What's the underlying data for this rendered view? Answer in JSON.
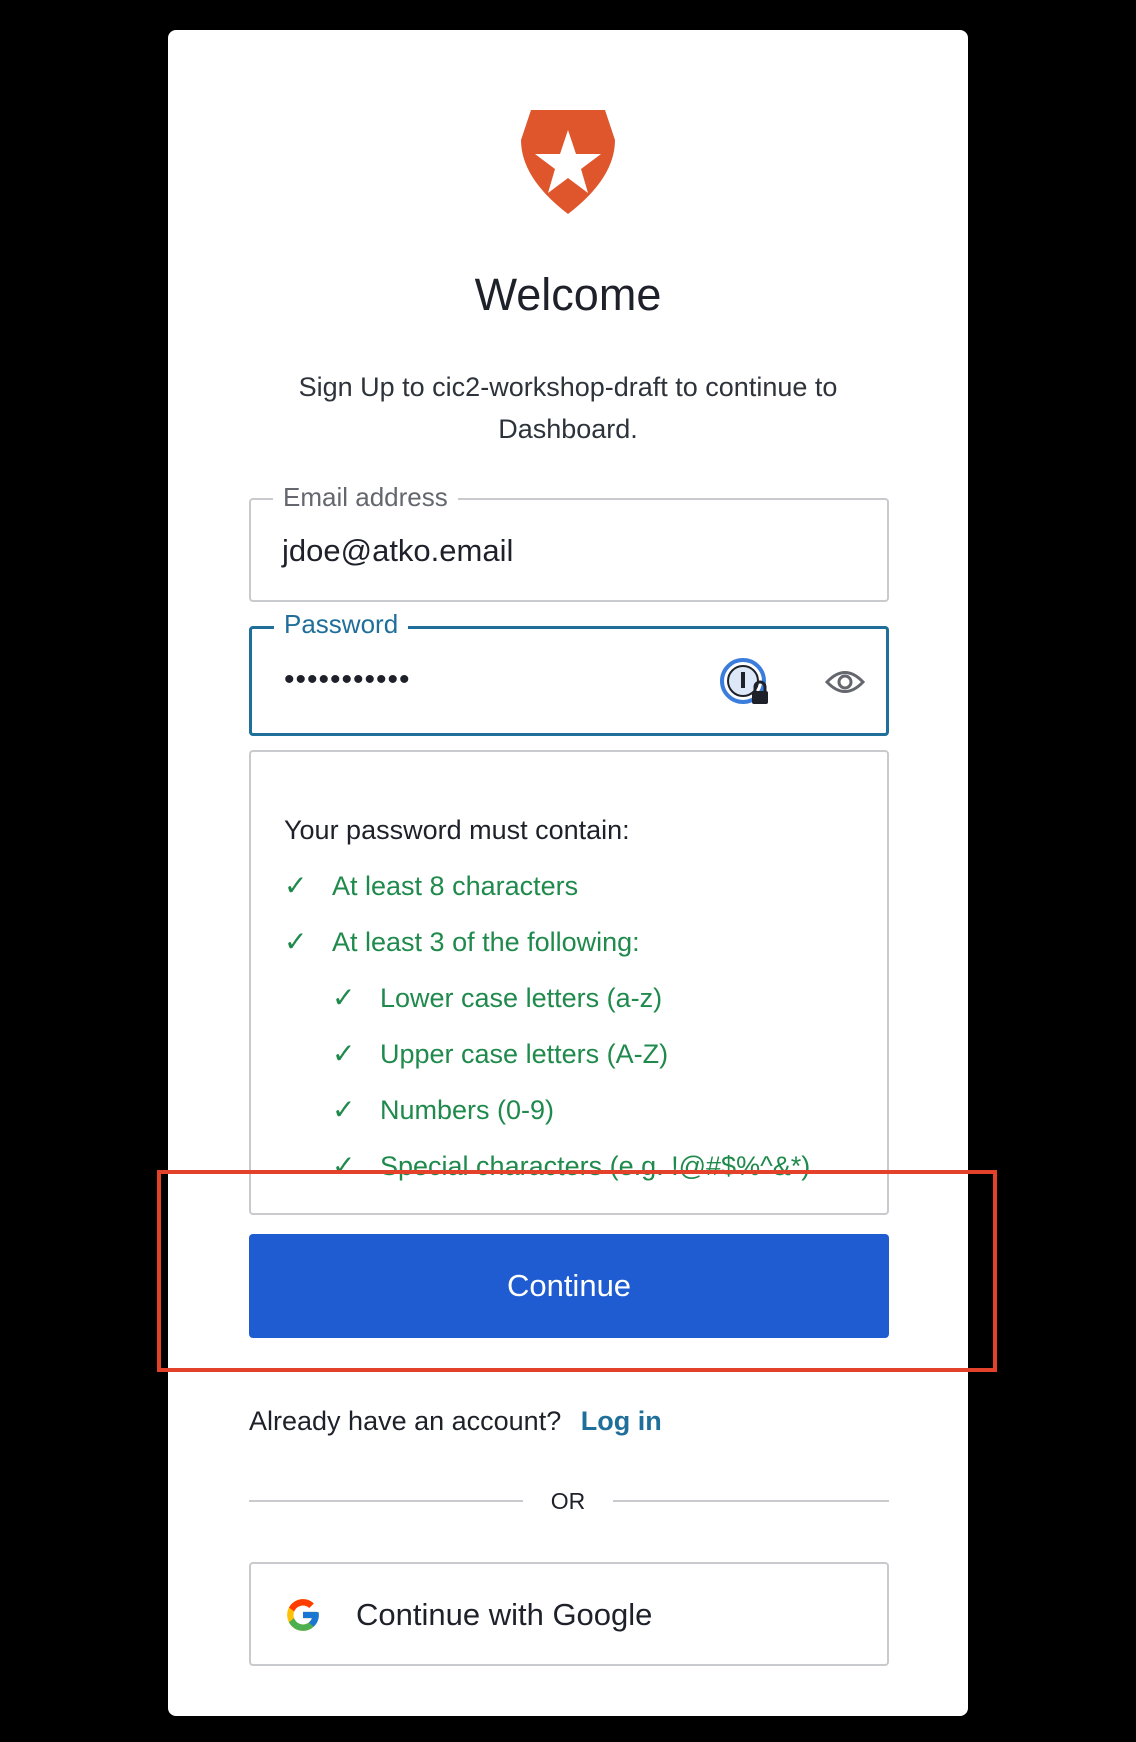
{
  "header": {
    "title": "Welcome",
    "subtitle": "Sign Up to cic2-workshop-draft to continue to Dashboard.",
    "logo_icon": "shield-star-icon",
    "logo_color": "#e0562c"
  },
  "form": {
    "email": {
      "label": "Email address",
      "value": "jdoe@atko.email"
    },
    "password": {
      "label": "Password",
      "value": "•••••••••••",
      "manager_icon": "password-manager-icon",
      "toggle_icon": "eye-icon"
    }
  },
  "requirements": {
    "heading": "Your password must contain:",
    "items": [
      {
        "label": "At least 8 characters",
        "met": true,
        "level": 0
      },
      {
        "label": "At least 3 of the following:",
        "met": true,
        "level": 0
      },
      {
        "label": "Lower case letters (a-z)",
        "met": true,
        "level": 1
      },
      {
        "label": "Upper case letters (A-Z)",
        "met": true,
        "level": 1
      },
      {
        "label": "Numbers (0-9)",
        "met": true,
        "level": 1
      },
      {
        "label": "Special characters (e.g. !@#$%^&*)",
        "met": true,
        "level": 1
      }
    ],
    "check_glyph": "✓",
    "met_color": "#1f8a4c"
  },
  "actions": {
    "continue_label": "Continue",
    "continue_color": "#1f5bd1",
    "login_prompt": "Already have an account?",
    "login_link": "Log in",
    "divider_text": "OR",
    "google_label": "Continue with Google"
  },
  "annotation": {
    "highlight_color": "#e3412a"
  }
}
